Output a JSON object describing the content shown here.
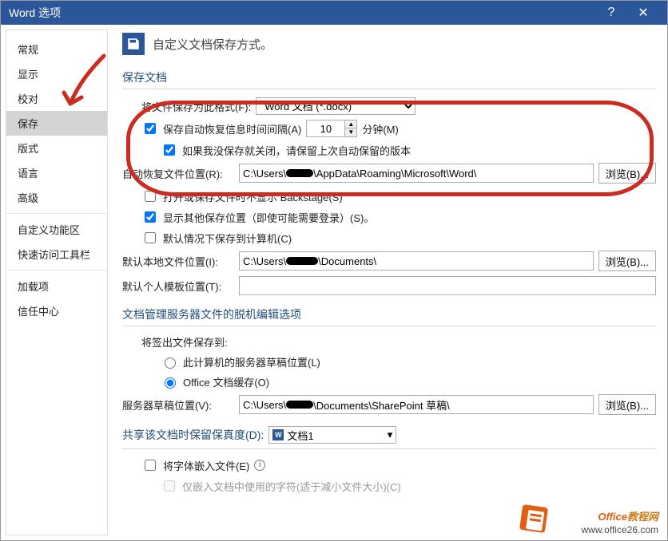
{
  "titlebar": {
    "title": "Word 选项",
    "help": "?",
    "close": "✕"
  },
  "sidebar": {
    "items": [
      {
        "label": "常规"
      },
      {
        "label": "显示"
      },
      {
        "label": "校对"
      },
      {
        "label": "保存",
        "selected": true
      },
      {
        "label": "版式"
      },
      {
        "label": "语言"
      },
      {
        "label": "高级"
      }
    ],
    "group2": [
      {
        "label": "自定义功能区"
      },
      {
        "label": "快速访问工具栏"
      }
    ],
    "group3": [
      {
        "label": "加载项"
      },
      {
        "label": "信任中心"
      }
    ]
  },
  "heading": "自定义文档保存方式。",
  "section_save_doc": "保存文档",
  "save_format_label": "将文件保存为此格式(F):",
  "save_format_value": "Word 文档 (*.docx)",
  "auto_recover_chk": "保存自动恢复信息时间间隔(A)",
  "auto_recover_minutes": "10",
  "minutes_label": "分钟(M)",
  "keep_last_chk": "如果我没保存就关闭，请保留上次自动保留的版本",
  "auto_recover_path_label": "自动恢复文件位置(R):",
  "auto_recover_path_value_pre": "C:\\Users\\",
  "auto_recover_path_value_post": "\\AppData\\Roaming\\Microsoft\\Word\\",
  "browse_btn": "浏览(B)...",
  "no_backstage_chk": "打开或保存文件时不显示 Backstage(S)",
  "show_other_loc_chk": "显示其他保存位置（即使可能需要登录）(S)。",
  "default_local_chk": "默认情况下保存到计算机(C)",
  "default_local_path_label": "默认本地文件位置(I):",
  "default_local_path_value_pre": "C:\\Users\\",
  "default_local_path_value_post": "\\Documents\\",
  "default_template_label": "默认个人模板位置(T):",
  "default_template_value": "",
  "section_offline": "文档管理服务器文件的脱机编辑选项",
  "checkout_to_label": "将签出文件保存到:",
  "radio_server_drafts": "此计算机的服务器草稿位置(L)",
  "radio_office_cache": "Office 文档缓存(O)",
  "server_drafts_label": "服务器草稿位置(V):",
  "server_drafts_value_pre": "C:\\Users\\",
  "server_drafts_value_post": "\\Documents\\SharePoint 草稿\\",
  "section_fidelity": "共享该文档时保留保真度(D):",
  "fidelity_doc": "文档1",
  "embed_fonts_chk": "将字体嵌入文件(E)",
  "embed_subset_chk": "仅嵌入文档中使用的字符(适于减小文件大小)(C)",
  "footer": {
    "brand1": "Office",
    "brand2": "教程网",
    "url": "www.office26.com"
  }
}
